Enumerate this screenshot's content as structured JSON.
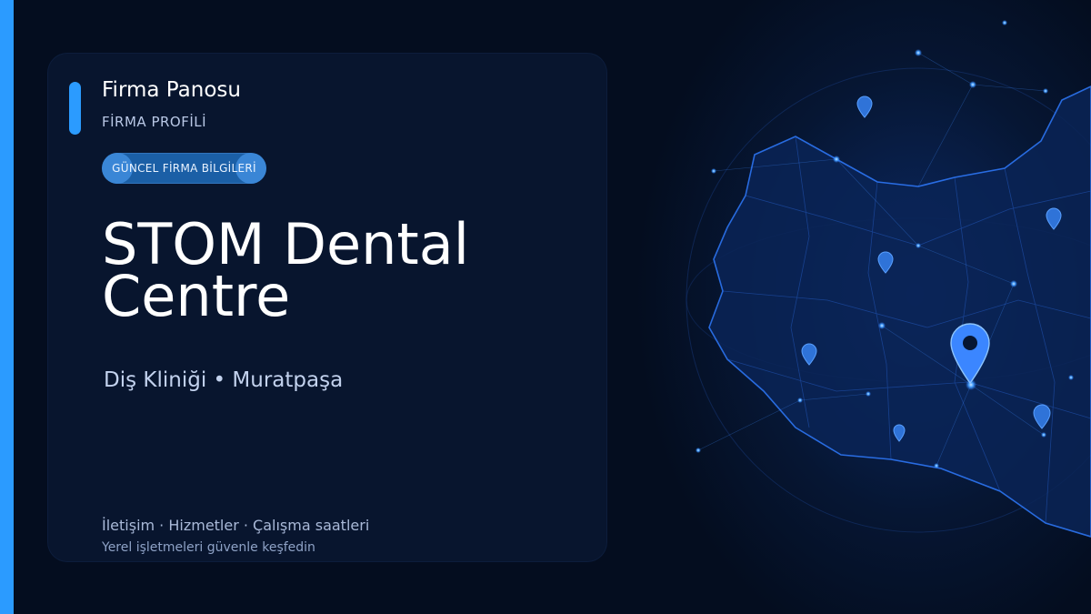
{
  "header": {
    "title": "Firma Panosu",
    "subtitle": "FİRMA PROFİLİ"
  },
  "badge": {
    "label": "GÜNCEL FİRMA BİLGİLERİ"
  },
  "business": {
    "name": "STOM Dental Centre",
    "category_line": "Diş Kliniği • Muratpaşa"
  },
  "footer": {
    "links_line": "İletişim · Hizmetler · Çalışma saatleri",
    "tagline": "Yerel işletmeleri güvenle keşfedin"
  },
  "icons": {
    "map": "map-illustration",
    "pins": "location-pin-icon"
  },
  "colors": {
    "background": "#040d1f",
    "card": "#08152e",
    "accent": "#2b9bff",
    "badge": "#1b5fa6"
  }
}
